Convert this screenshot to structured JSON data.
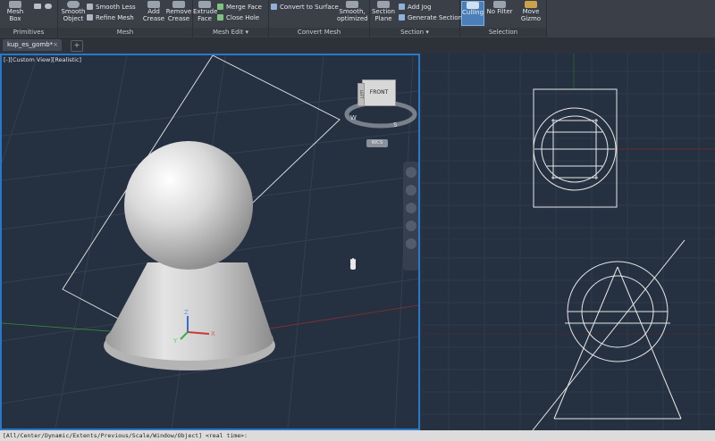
{
  "ribbon": {
    "panels": [
      {
        "title": "Primitives"
      },
      {
        "title": "Mesh"
      },
      {
        "title": "Mesh Edit"
      },
      {
        "title": "Convert Mesh"
      },
      {
        "title": "Section"
      },
      {
        "title": "Selection"
      }
    ],
    "tools": {
      "mesh_box": "Mesh Box",
      "smooth_object": "Smooth Object",
      "smooth_less": "Smooth Less",
      "refine_mesh": "Refine Mesh",
      "add_crease": "Add Crease",
      "remove_crease": "Remove Crease",
      "extrude_face": "Extrude Face",
      "merge_face": "Merge Face",
      "close_hole": "Close Hole",
      "convert_to_surface": "Convert to Surface",
      "smooth_optimized": "Smooth, optimized",
      "section_plane": "Section Plane",
      "add_jog": "Add Jog",
      "generate_section": "Generate Section",
      "culling": "Culling",
      "no_filter": "No Filter",
      "move_gizmo": "Move Gizmo"
    }
  },
  "tabs": {
    "document": "kup_es_gomb*",
    "close": "×",
    "new": "+"
  },
  "viewports": {
    "main_label": "[-][Custom View][Realistic]"
  },
  "viewcube": {
    "face_label": "FRONT",
    "side_label": "LEFT",
    "compass": {
      "w": "W",
      "s": "S"
    },
    "wcs": "WCS"
  },
  "command_line": "[All/Center/Dynamic/Extents/Previous/Scale/Window/Object] <real time>:",
  "colors": {
    "ribbon_bg": "#3a3f48",
    "viewport_bg": "#253040",
    "active_border": "#2a78c8",
    "axis_red": "#c83a3a",
    "axis_green": "#3ab04a",
    "axis_blue": "#3a6ad8"
  }
}
